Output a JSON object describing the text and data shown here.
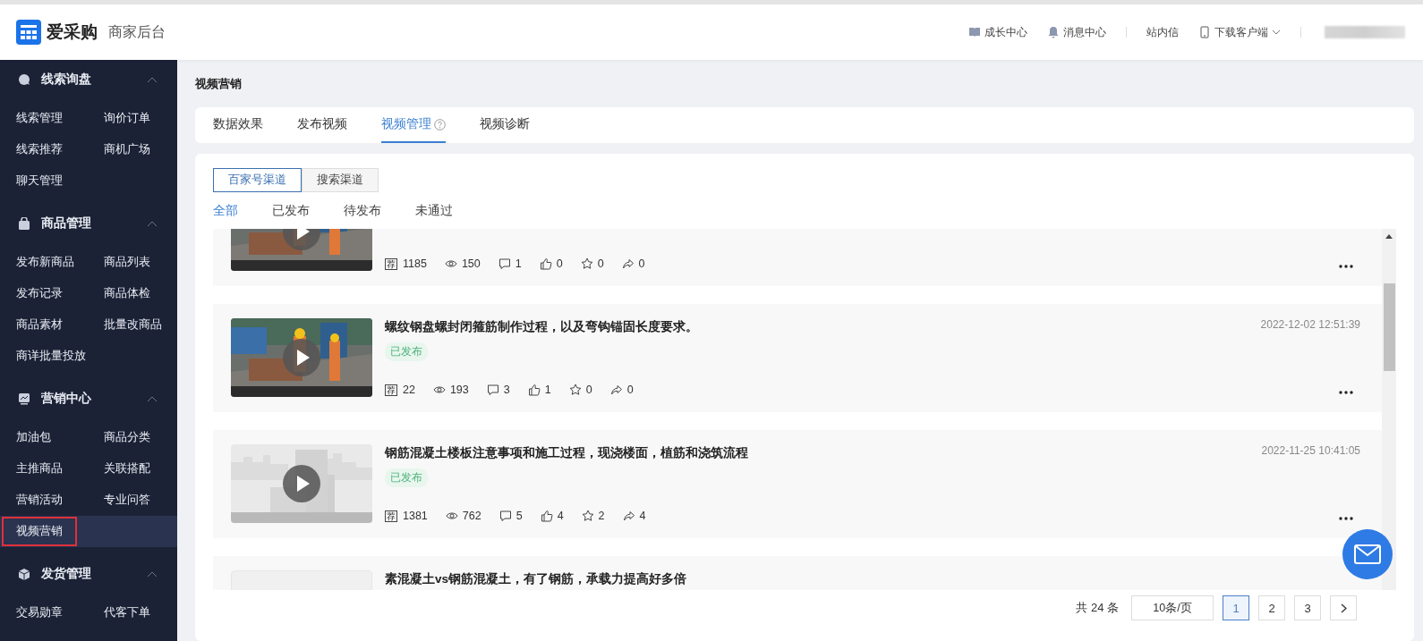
{
  "header": {
    "logo": "爱采购",
    "subtitle": "商家后台",
    "links": [
      {
        "kind": "book",
        "label": "成长中心",
        "divider_after": false
      },
      {
        "kind": "bell",
        "label": "消息中心",
        "divider_after": true
      },
      {
        "kind": "plain",
        "label": "站内信",
        "divider_after": false
      },
      {
        "kind": "phone",
        "label": "下载客户端",
        "divider_after": true
      }
    ]
  },
  "sidebar": {
    "sections": [
      {
        "title": "线索询盘",
        "expanded": true,
        "items": [
          {
            "label": "线索管理",
            "selected": false
          },
          {
            "label": "询价订单",
            "selected": false
          },
          {
            "label": "线索推荐",
            "selected": false
          },
          {
            "label": "商机广场",
            "selected": false
          },
          {
            "label": "聊天管理",
            "selected": false
          }
        ]
      },
      {
        "title": "商品管理",
        "expanded": true,
        "items": [
          {
            "label": "发布新商品",
            "selected": false
          },
          {
            "label": "商品列表",
            "selected": false
          },
          {
            "label": "发布记录",
            "selected": false
          },
          {
            "label": "商品体检",
            "selected": false
          },
          {
            "label": "商品素材",
            "selected": false
          },
          {
            "label": "批量改商品",
            "selected": false
          },
          {
            "label": "商详批量投放",
            "selected": false
          }
        ]
      },
      {
        "title": "营销中心",
        "expanded": true,
        "items": [
          {
            "label": "加油包",
            "selected": false
          },
          {
            "label": "商品分类",
            "selected": false
          },
          {
            "label": "主推商品",
            "selected": false
          },
          {
            "label": "关联搭配",
            "selected": false
          },
          {
            "label": "营销活动",
            "selected": false
          },
          {
            "label": "专业问答",
            "selected": false
          },
          {
            "label": "视频营销",
            "selected": true
          }
        ]
      },
      {
        "title": "发货管理",
        "expanded": true,
        "items": [
          {
            "label": "交易勋章",
            "selected": false
          },
          {
            "label": "代客下单",
            "selected": false
          }
        ]
      }
    ]
  },
  "page_title": "视频营销",
  "tabs": [
    {
      "label": "数据效果",
      "selected": false,
      "help": false
    },
    {
      "label": "发布视频",
      "selected": false,
      "help": false
    },
    {
      "label": "视频管理",
      "selected": true,
      "help": true
    },
    {
      "label": "视频诊断",
      "selected": false,
      "help": false
    }
  ],
  "channels": [
    {
      "label": "百家号渠道",
      "selected": true
    },
    {
      "label": "搜索渠道",
      "selected": false
    }
  ],
  "filters": [
    {
      "label": "全部",
      "selected": true
    },
    {
      "label": "已发布",
      "selected": false
    },
    {
      "label": "待发布",
      "selected": false
    },
    {
      "label": "未通过",
      "selected": false
    }
  ],
  "videos": [
    {
      "partial": true,
      "stats": [
        {
          "kind": "recommend",
          "label": "荐",
          "value": "1185"
        },
        {
          "kind": "views",
          "value": "150"
        },
        {
          "kind": "comments",
          "value": "1"
        },
        {
          "kind": "likes",
          "value": "0"
        },
        {
          "kind": "favorites",
          "value": "0"
        },
        {
          "kind": "shares",
          "value": "0"
        }
      ]
    },
    {
      "partial": false,
      "title": "螺纹钢盘螺封闭箍筋制作过程，以及弯钩锚固长度要求。",
      "status": "已发布",
      "date": "2022-12-02 12:51:39",
      "stats": [
        {
          "kind": "recommend",
          "label": "荐",
          "value": "22"
        },
        {
          "kind": "views",
          "value": "193"
        },
        {
          "kind": "comments",
          "value": "3"
        },
        {
          "kind": "likes",
          "value": "1"
        },
        {
          "kind": "favorites",
          "value": "0"
        },
        {
          "kind": "shares",
          "value": "0"
        }
      ]
    },
    {
      "partial": false,
      "kind": "placeholder",
      "title": "钢筋混凝土楼板注意事项和施工过程，现浇楼面，植筋和浇筑流程",
      "status": "已发布",
      "date": "2022-11-25 10:41:05",
      "stats": [
        {
          "kind": "recommend",
          "label": "荐",
          "value": "1381"
        },
        {
          "kind": "views",
          "value": "762"
        },
        {
          "kind": "comments",
          "value": "5"
        },
        {
          "kind": "likes",
          "value": "4"
        },
        {
          "kind": "favorites",
          "value": "2"
        },
        {
          "kind": "shares",
          "value": "4"
        }
      ]
    },
    {
      "partial": false,
      "kind": "blank",
      "title": "素混凝土vs钢筋混凝土，有了钢筋，承载力提高好多倍"
    }
  ],
  "pagination": {
    "total": "共 24 条",
    "page_size": "10条/页",
    "pages": [
      {
        "label": "1",
        "selected": true
      },
      {
        "label": "2",
        "selected": false
      },
      {
        "label": "3",
        "selected": false
      }
    ]
  }
}
